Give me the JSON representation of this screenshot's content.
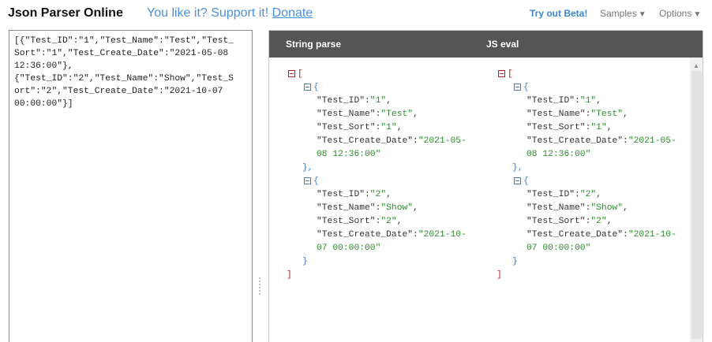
{
  "header": {
    "title": "Json Parser Online",
    "support_text": "You like it? Support it!",
    "donate_label": "Donate",
    "beta_label": "Try out Beta!",
    "samples_label": "Samples",
    "options_label": "Options",
    "dropdown_arrow": "▼"
  },
  "input": {
    "lines": [
      "[{\"Test_ID\":\"1\",\"Test_Name\":\"Test\",\"Test_",
      "Sort\":\"1\",\"Test_Create_Date\":\"2021-05-08",
      "12:36:00\"},",
      "{\"Test_ID\":\"2\",\"Test_Name\":\"Show\",\"Test_S",
      "ort\":\"2\",\"Test_Create_Date\":\"2021-10-07",
      "00:00:00\"}]"
    ]
  },
  "output": {
    "tabs": [
      {
        "label": "String parse"
      },
      {
        "label": "JS eval"
      }
    ],
    "tree": {
      "open_bracket": "[",
      "close_bracket": "]",
      "object_open": "{",
      "object_close_comma": "},",
      "object_close": "}",
      "records": [
        {
          "fields": [
            {
              "key": "\"Test_ID\"",
              "value": "\"1\""
            },
            {
              "key": "\"Test_Name\"",
              "value": "\"Test\""
            },
            {
              "key": "\"Test_Sort\"",
              "value": "\"1\""
            },
            {
              "key": "\"Test_Create_Date\"",
              "value": "\"2021-05-",
              "value_cont": "08 12:36:00\""
            }
          ]
        },
        {
          "fields": [
            {
              "key": "\"Test_ID\"",
              "value": "\"2\""
            },
            {
              "key": "\"Test_Name\"",
              "value": "\"Show\""
            },
            {
              "key": "\"Test_Sort\"",
              "value": "\"2\""
            },
            {
              "key": "\"Test_Create_Date\"",
              "value": "\"2021-10-",
              "value_cont": "07 00:00:00\""
            }
          ]
        }
      ]
    }
  },
  "icons": {
    "collapse": "collapse-minus-icon",
    "scroll_up": "▲"
  },
  "colors": {
    "header_bg": "#555555",
    "link_blue": "#4a90d9",
    "string_green": "#2e8b2e",
    "array_red": "#b22222",
    "object_blue": "#4a7fb5"
  }
}
